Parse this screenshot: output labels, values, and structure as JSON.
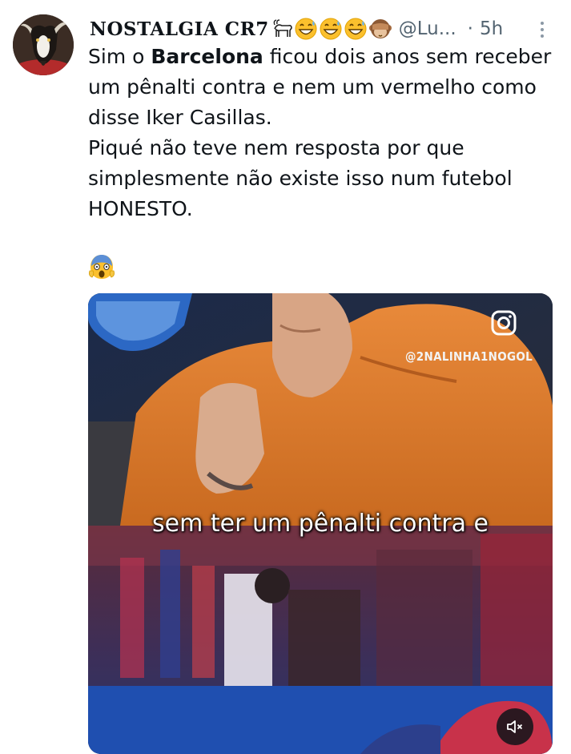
{
  "tweet": {
    "display_name": "NOSTALGIA CR7",
    "name_emojis": [
      "goat-emoji",
      "grinning-sweat-emoji",
      "grinning-sweat-emoji",
      "grinning-sweat-emoji",
      "see-no-evil-monkey-emoji"
    ],
    "handle": "@Lu...",
    "separator": "·",
    "time": "5h",
    "text_lines": {
      "p1_pre": "Sim o ",
      "p1_bold": "Barcelona",
      "p1_post": " ficou dois anos sem receber um pênalti contra e nem um vermelho como disse Iker Casillas.",
      "p2": "Piqué não teve nem resposta por que simplesmente não existe isso num futebol HONESTO."
    },
    "trailing_emoji": "screaming-face-emoji"
  },
  "media": {
    "watermark": "@2NALINHA1NOGOL",
    "caption": "sem ter um pênalti contra e",
    "mute_icon": "speaker-muted-icon"
  },
  "colors": {
    "text": "#0f1419",
    "secondary": "#536471",
    "hoodie": "#e07a2e"
  }
}
